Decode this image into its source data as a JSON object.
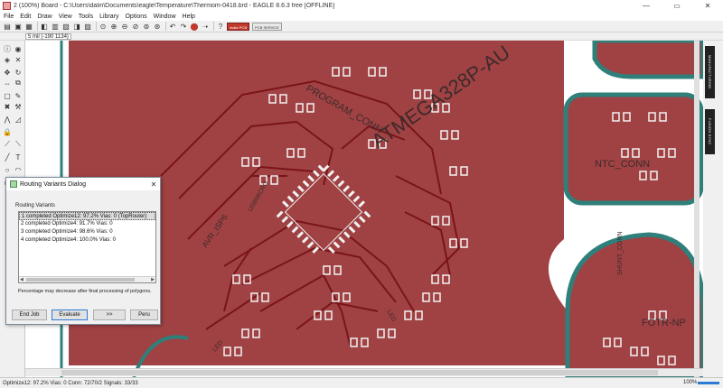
{
  "window": {
    "title": "2 (100%) Board - C:\\Users\\dalin\\Documents\\eagle\\Temperature\\Thermom-0418.brd - EAGLE 8.6.3 free [OFFLINE]",
    "minimize": "—",
    "maximize": "▭",
    "close": "✕"
  },
  "menu": [
    "File",
    "Edit",
    "Draw",
    "View",
    "Tools",
    "Library",
    "Options",
    "Window",
    "Help"
  ],
  "toolbar": {
    "badge_1": "make PCB",
    "badge_2": "PCB SERVICE"
  },
  "coords": "5 mil (-190 1134)",
  "board": {
    "labels": [
      "ATMEGA328P-AU",
      "PROGRAM_CONN",
      "NTC_CONN",
      "AVR_ISP6",
      "LED",
      "USBMICRO",
      "FOTR-NP",
      "LED",
      "SHUNT_CONN"
    ]
  },
  "right_tabs": [
    "MANUFACTURING",
    "FUSION SYNC"
  ],
  "dialog": {
    "title": "Routing Variants Dialog",
    "close": "✕",
    "group_label": "Routing Variants",
    "rows": [
      "1 completed Optimize12:  97.2%  Vias: 0 (TopRouter)",
      "2 completed Optimize4:  91.7%  Vias: 0",
      "3 completed Optimize4:  98.6%  Vias: 0",
      "4 completed Optimize4:  100.0%  Vias: 0"
    ],
    "note": "Percentage may decrease after final processing of polygons.",
    "buttons": {
      "end_job": "End Job",
      "evaluate": "Evaluate",
      "next": ">>",
      "peru": "Peru"
    }
  },
  "status": {
    "text": "Optimize12:  97.2%  Vias: 0  Conn: 72/70/2  Signals: 33/33",
    "zoom": "100%"
  },
  "colors": {
    "board_fill": "#a04244",
    "canvas_bg": "#ffffff",
    "trace": "#7a1418",
    "outline": "#2f7f7a",
    "pad": "#f2f2f2"
  }
}
